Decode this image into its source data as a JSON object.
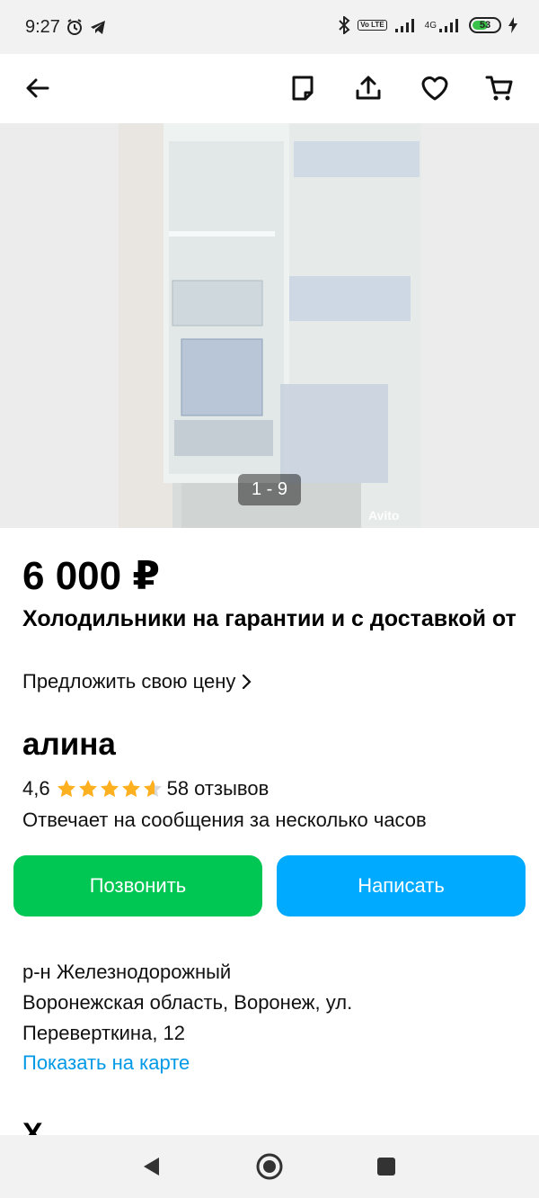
{
  "status_bar": {
    "time": "9:27",
    "network": "4G",
    "volte": "Vo LTE",
    "battery": "53"
  },
  "app_bar": {
    "icons": [
      "back-arrow-icon",
      "note-icon",
      "share-icon",
      "heart-icon",
      "cart-icon"
    ]
  },
  "gallery": {
    "counter": "1 - 9",
    "watermark": "Avito"
  },
  "listing": {
    "price": "6 000 ₽",
    "title": "Холодильники на гарантии и с доставкой от",
    "offer_price_link": "Предложить свою цену"
  },
  "seller": {
    "name": "алина",
    "rating": "4,6",
    "rating_value": 4.6,
    "reviews": "58 отзывов",
    "response_time": "Отвечает на сообщения за несколько часов"
  },
  "actions": {
    "call_label": "Позвонить",
    "write_label": "Написать"
  },
  "location": {
    "district": "р-н Железнодорожный",
    "address_line1": "Воронежская область, Воронеж, ул.",
    "address_line2": "Переверткина, 12",
    "map_link": "Показать на карте"
  },
  "colors": {
    "call_button": "#00c754",
    "write_button": "#00aaff",
    "link": "#0099e6",
    "star": "#ffb021"
  }
}
